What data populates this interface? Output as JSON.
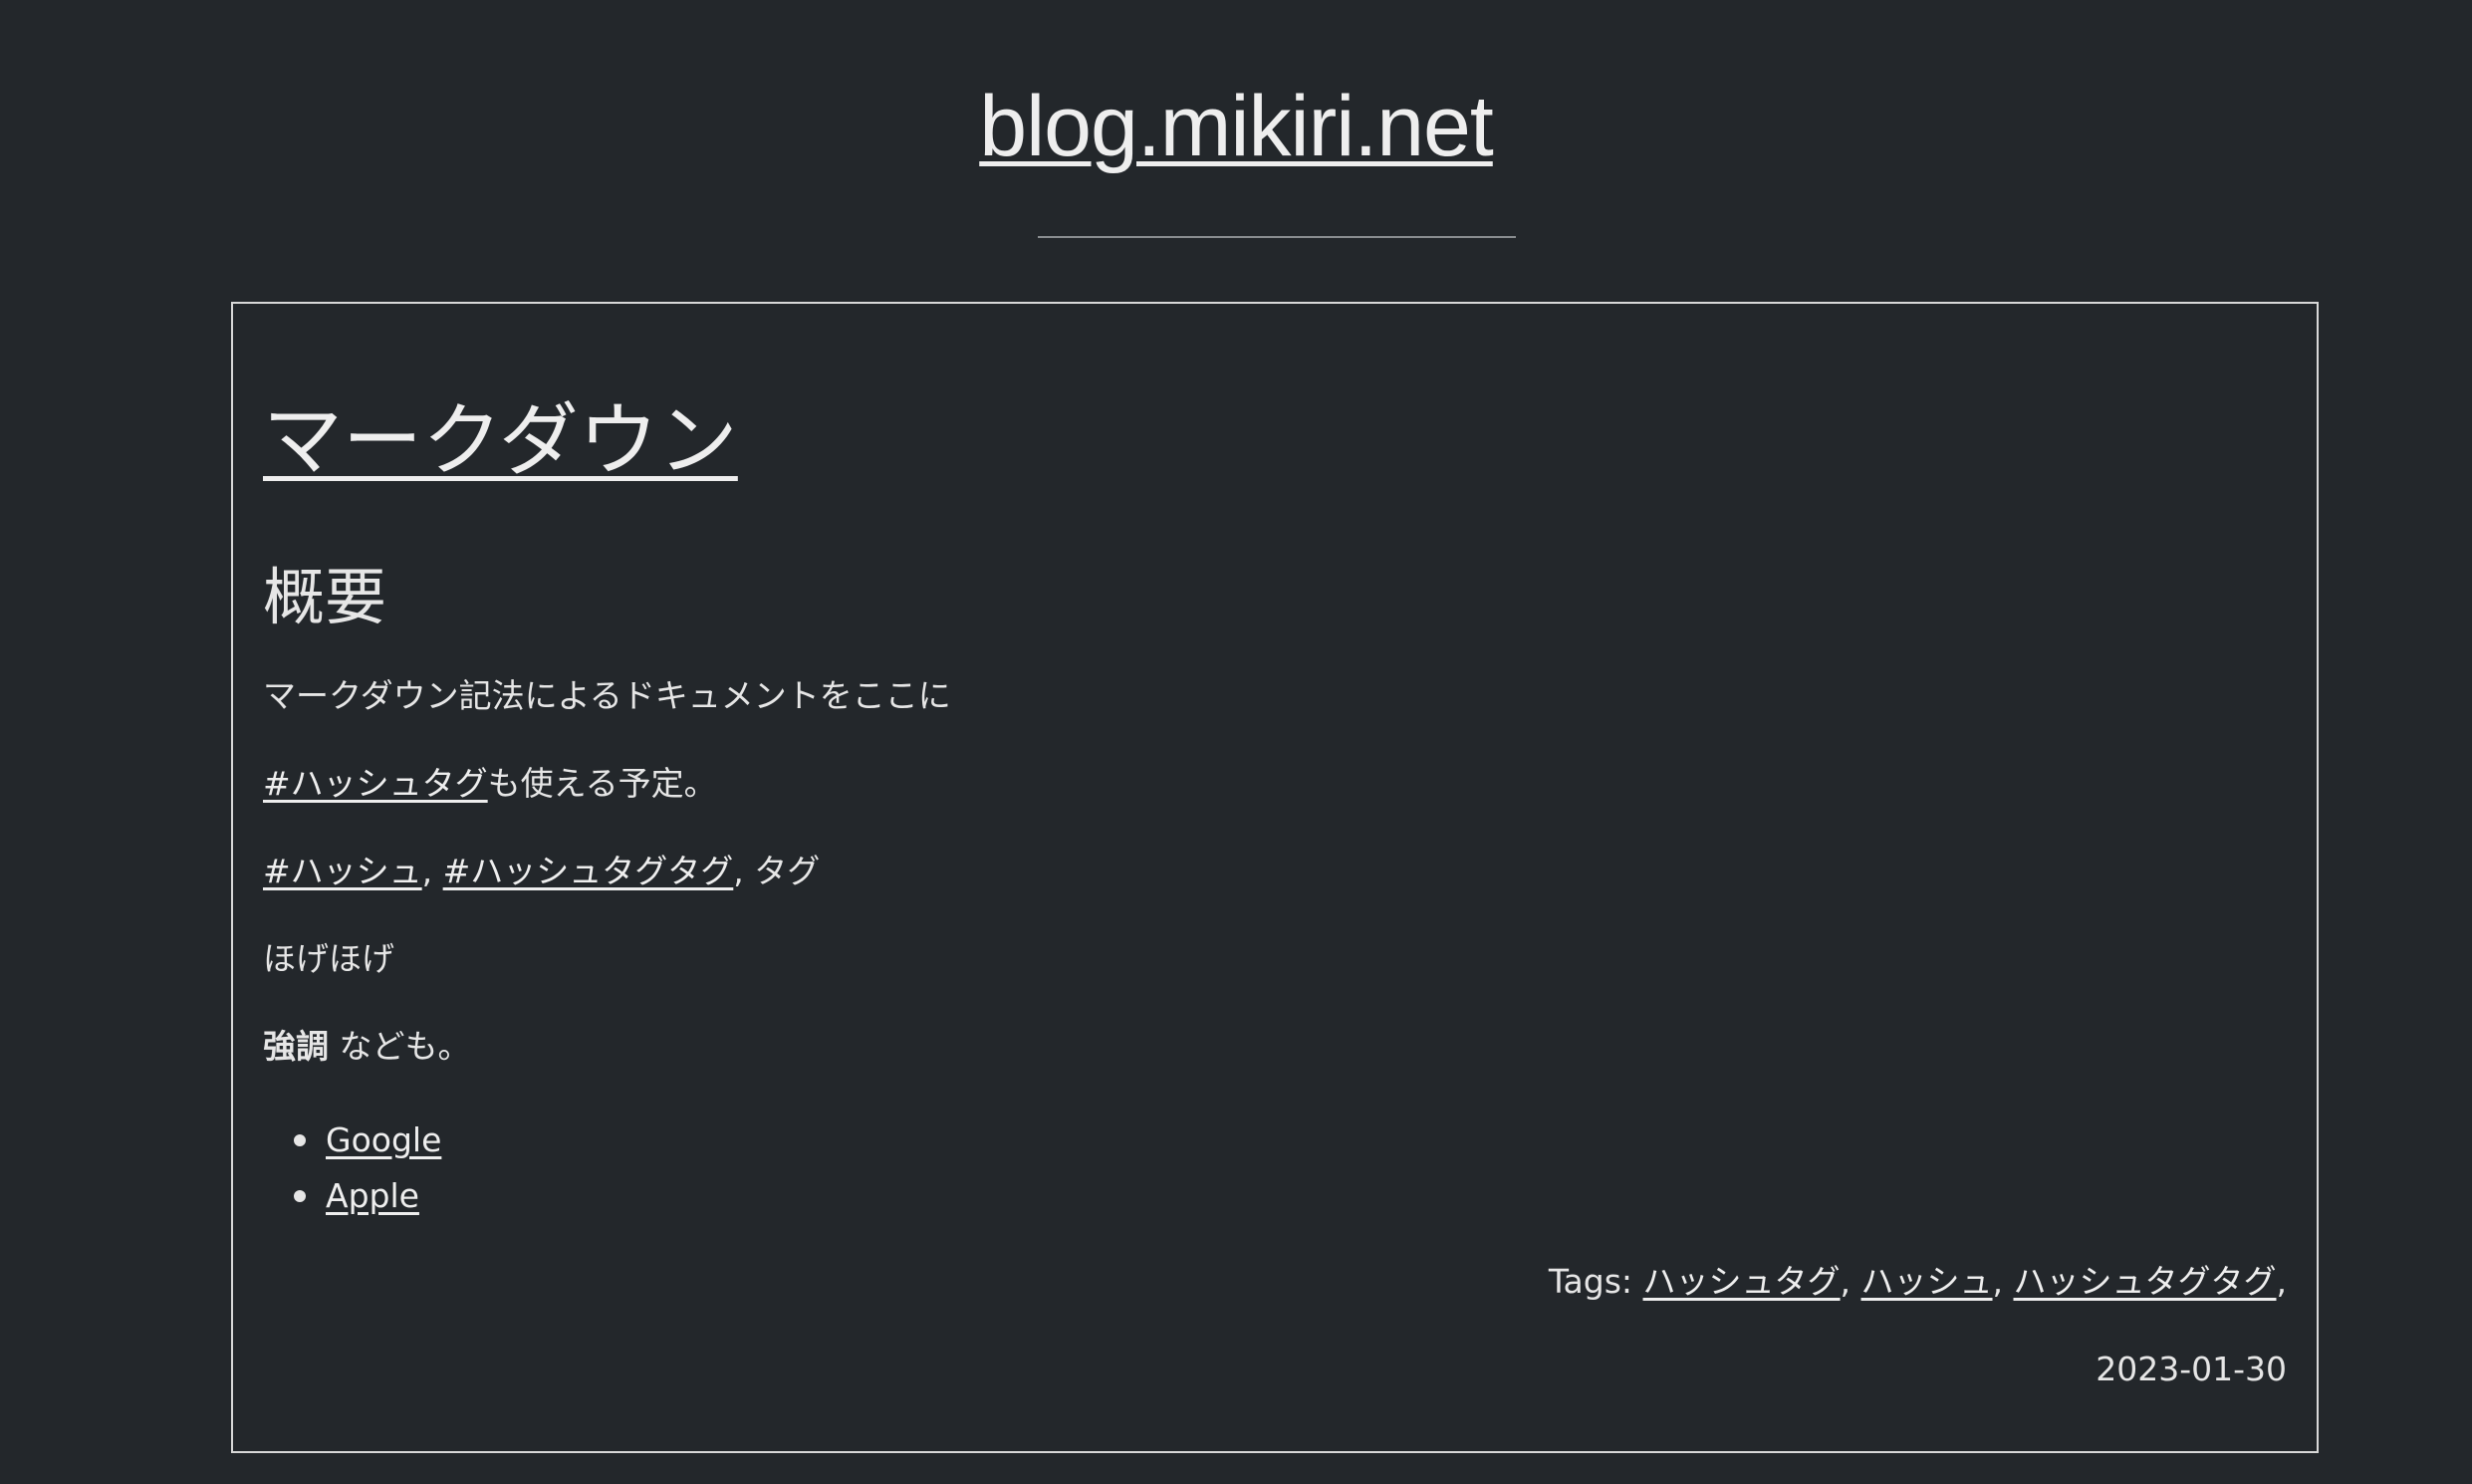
{
  "site": {
    "title": "blog.mikiri.net"
  },
  "post": {
    "title": "マークダウン",
    "section_heading": "概要",
    "paragraph_1": "マークダウン記法によるドキュメントをここに",
    "paragraph_2": {
      "hashtag_link": "#ハッシュタグ",
      "rest": "も使える予定。"
    },
    "paragraph_3": {
      "hashtag_1": "#ハッシュ",
      "sep_1": ", ",
      "hashtag_2": "#ハッシュタグタグ",
      "rest": ", タグ"
    },
    "paragraph_4": "ほげほげ",
    "paragraph_5": {
      "strong": "強調",
      "rest": " なども。"
    },
    "links": [
      {
        "label": "Google"
      },
      {
        "label": "Apple"
      }
    ],
    "tags_label": "Tags: ",
    "tags": [
      {
        "label": "ハッシュタグ"
      },
      {
        "label": "ハッシュ"
      },
      {
        "label": "ハッシュタグタグ"
      }
    ],
    "tag_separator": ", ",
    "trailing_separator": ",",
    "date": "2023-01-30"
  },
  "colors": {
    "background": "#23272b",
    "text": "#e6e6e6",
    "border": "#d8d8d8"
  }
}
